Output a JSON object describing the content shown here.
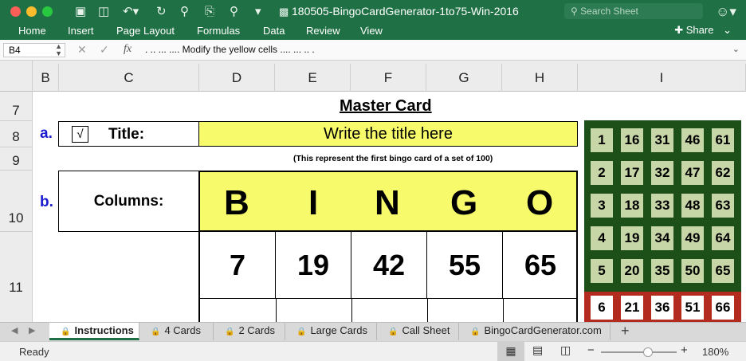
{
  "window": {
    "title": "180505-BingoCardGenerator-1to75-Win-2016",
    "search_placeholder": "Search Sheet"
  },
  "ribbon": {
    "tabs": [
      "Home",
      "Insert",
      "Page Layout",
      "Formulas",
      "Data",
      "Review",
      "View"
    ],
    "share_label": "Share"
  },
  "formula_bar": {
    "cell_ref": "B4",
    "content": ". .. ... .... Modify the yellow cells .... ... .. ."
  },
  "columns": [
    "B",
    "C",
    "D",
    "E",
    "F",
    "G",
    "H",
    "I"
  ],
  "rows": [
    "7",
    "8",
    "9",
    "10",
    "11"
  ],
  "sheet": {
    "master_card": "Master Card",
    "label_a": "a.",
    "title_label": "Title:",
    "title_value": "Write the title here",
    "title_note": "(This represent the first bingo card of a set of 100)",
    "label_b": "b.",
    "columns_label": "Columns:",
    "bingo_letters": [
      "B",
      "I",
      "N",
      "G",
      "O"
    ],
    "first_row_numbers": [
      "7",
      "19",
      "42",
      "55",
      "65"
    ],
    "checkbox_mark": "√"
  },
  "master_grid": {
    "green_rows": [
      [
        "1",
        "16",
        "31",
        "46",
        "61"
      ],
      [
        "2",
        "17",
        "32",
        "47",
        "62"
      ],
      [
        "3",
        "18",
        "33",
        "48",
        "63"
      ],
      [
        "4",
        "19",
        "34",
        "49",
        "64"
      ],
      [
        "5",
        "20",
        "35",
        "50",
        "65"
      ]
    ],
    "red_row": [
      "6",
      "21",
      "36",
      "51",
      "66"
    ]
  },
  "sheet_tabs": [
    "Instructions",
    "4 Cards",
    "2 Cards",
    "Large Cards",
    "Call Sheet",
    "BingoCardGenerator.com"
  ],
  "status": {
    "ready": "Ready",
    "zoom": "180%"
  },
  "colors": {
    "excel_green": "#1f7145",
    "yellow": "#f7fb6b",
    "board_green": "#1d4f18",
    "cell_green": "#c7d6a7",
    "board_red": "#b32a1f"
  }
}
